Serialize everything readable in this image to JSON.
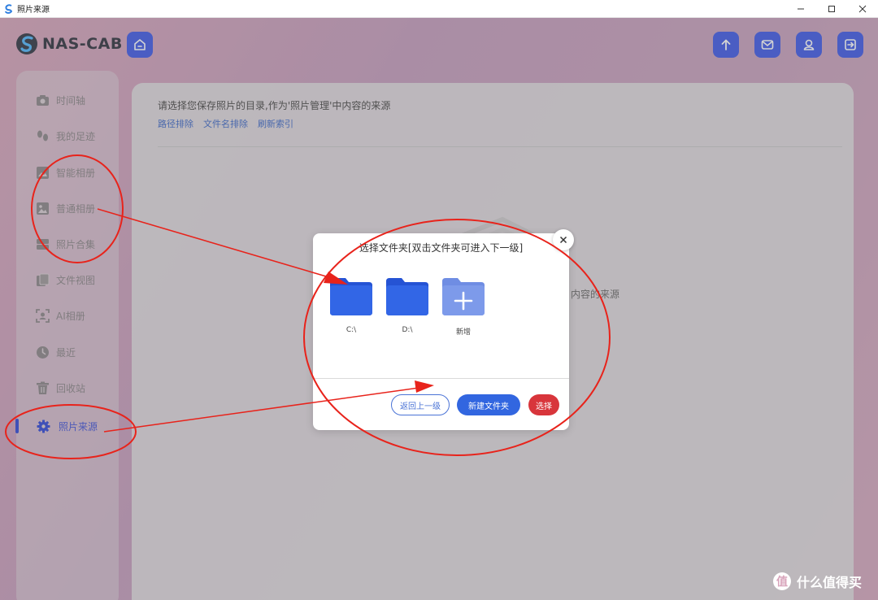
{
  "window": {
    "title": "照片来源"
  },
  "header": {
    "logo_text": "NAS-CAB",
    "home_icon": "home-icon",
    "actions": [
      {
        "name": "upload",
        "icon": "upload-icon"
      },
      {
        "name": "mail",
        "icon": "mail-icon"
      },
      {
        "name": "user",
        "icon": "user-icon"
      },
      {
        "name": "logout",
        "icon": "logout-icon"
      }
    ]
  },
  "sidebar": {
    "items": [
      {
        "label": "时间轴",
        "icon": "camera-icon"
      },
      {
        "label": "我的足迹",
        "icon": "footprint-icon"
      },
      {
        "label": "智能相册",
        "icon": "smart-album-icon"
      },
      {
        "label": "普通相册",
        "icon": "image-icon"
      },
      {
        "label": "照片合集",
        "icon": "collection-icon"
      },
      {
        "label": "文件视图",
        "icon": "files-icon"
      },
      {
        "label": "AI相册",
        "icon": "ai-scan-icon"
      },
      {
        "label": "最近",
        "icon": "clock-icon"
      },
      {
        "label": "回收站",
        "icon": "trash-icon"
      },
      {
        "label": "照片来源",
        "icon": "gear-icon",
        "active": true
      }
    ]
  },
  "content": {
    "hint": "请选择您保存照片的目录,作为'照片管理'中内容的来源",
    "links": [
      "路径排除",
      "文件名排除",
      "刷新索引"
    ],
    "background_text": "内容的来源"
  },
  "dialog": {
    "title": "选择文件夹[双击文件夹可进入下一级]",
    "folders": [
      {
        "label": "C:\\",
        "type": "folder"
      },
      {
        "label": "D:\\",
        "type": "folder"
      },
      {
        "label": "新增",
        "type": "add"
      }
    ],
    "buttons": {
      "back": "返回上一级",
      "new_folder": "新建文件夹",
      "select": "选择"
    }
  },
  "watermark": {
    "text": "什么值得买"
  },
  "colors": {
    "primary": "#3b57e8",
    "folder": "#2f64e0",
    "folder_add": "#7b98e8",
    "danger": "#d8353b",
    "annotation": "#e8231b"
  }
}
